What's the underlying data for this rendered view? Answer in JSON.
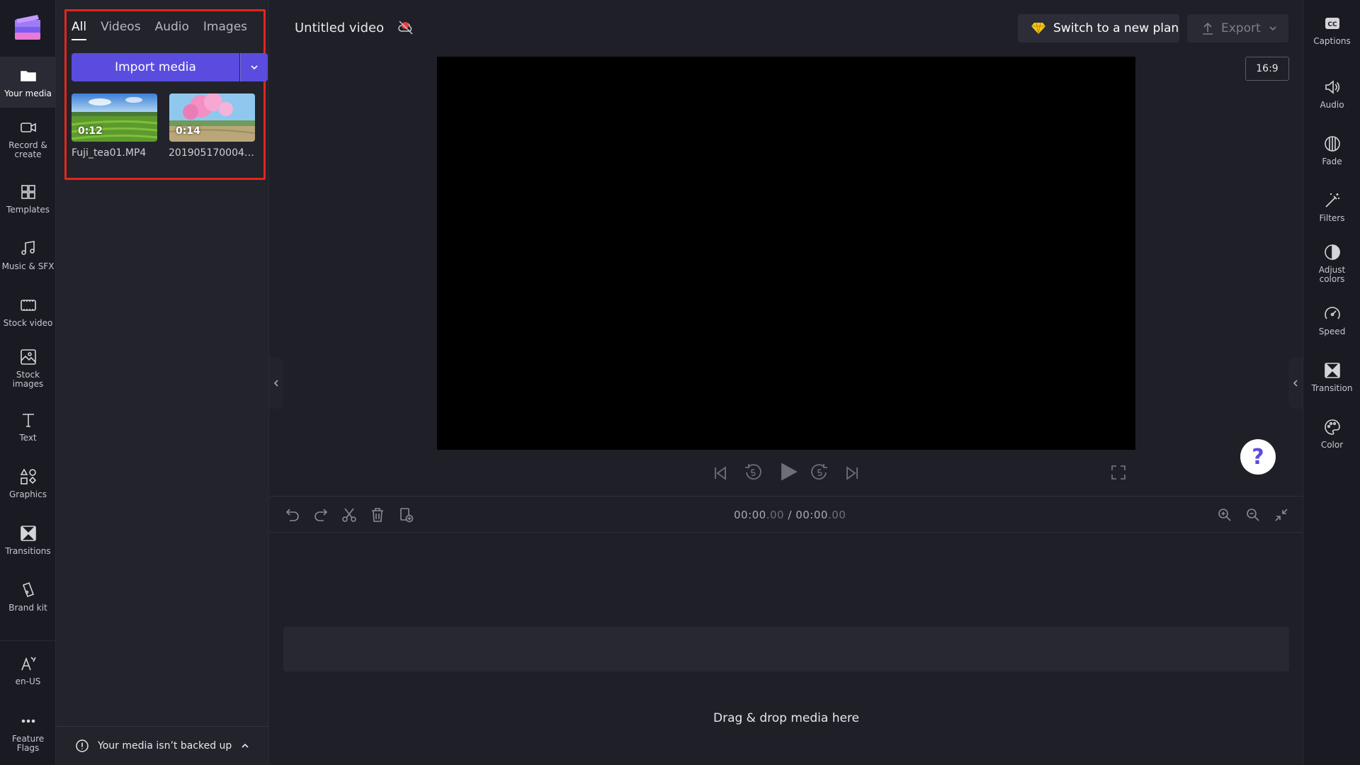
{
  "left_nav": [
    {
      "label": "Your media",
      "icon": "folder-icon"
    },
    {
      "label": "Record & create",
      "icon": "video-camera-icon"
    },
    {
      "label": "Templates",
      "icon": "templates-icon"
    },
    {
      "label": "Music & SFX",
      "icon": "music-note-icon"
    },
    {
      "label": "Stock video",
      "icon": "film-icon"
    },
    {
      "label": "Stock images",
      "icon": "image-icon"
    },
    {
      "label": "Text",
      "icon": "text-icon"
    },
    {
      "label": "Graphics",
      "icon": "shapes-icon"
    },
    {
      "label": "Transitions",
      "icon": "transition-icon"
    },
    {
      "label": "Brand kit",
      "icon": "brand-kit-icon"
    },
    {
      "label": "en-US",
      "icon": "language-icon"
    },
    {
      "label": "Feature Flags",
      "icon": "more-dots-icon"
    }
  ],
  "media": {
    "tabs": [
      "All",
      "Videos",
      "Audio",
      "Images"
    ],
    "import_label": "Import media",
    "items": [
      {
        "duration": "0:12",
        "name": "Fuji_tea01.MP4"
      },
      {
        "duration": "0:14",
        "name": "20190517000409..."
      }
    ],
    "backup_text": "Your media isn’t backed up"
  },
  "header": {
    "title": "Untitled video",
    "plan_label": "Switch to a new plan",
    "export_label": "Export",
    "ratio": "16:9"
  },
  "timeline": {
    "current": "00:00",
    "current_frac": ".00",
    "total": "00:00",
    "total_frac": ".00",
    "separator": "/",
    "drop_text": "Drag & drop media here"
  },
  "right_nav": [
    {
      "label": "Captions",
      "icon": "captions-icon"
    },
    {
      "label": "Audio",
      "icon": "speaker-icon"
    },
    {
      "label": "Fade",
      "icon": "fade-icon"
    },
    {
      "label": "Filters",
      "icon": "magic-wand-icon"
    },
    {
      "label": "Adjust colors",
      "icon": "contrast-icon"
    },
    {
      "label": "Speed",
      "icon": "speedometer-icon"
    },
    {
      "label": "Transition",
      "icon": "transition-icon"
    },
    {
      "label": "Color",
      "icon": "palette-icon"
    }
  ],
  "help_label": "?",
  "colors": {
    "accent": "#5b4ce0",
    "highlight": "#e3261c",
    "plan_gem": "#f5c518"
  }
}
